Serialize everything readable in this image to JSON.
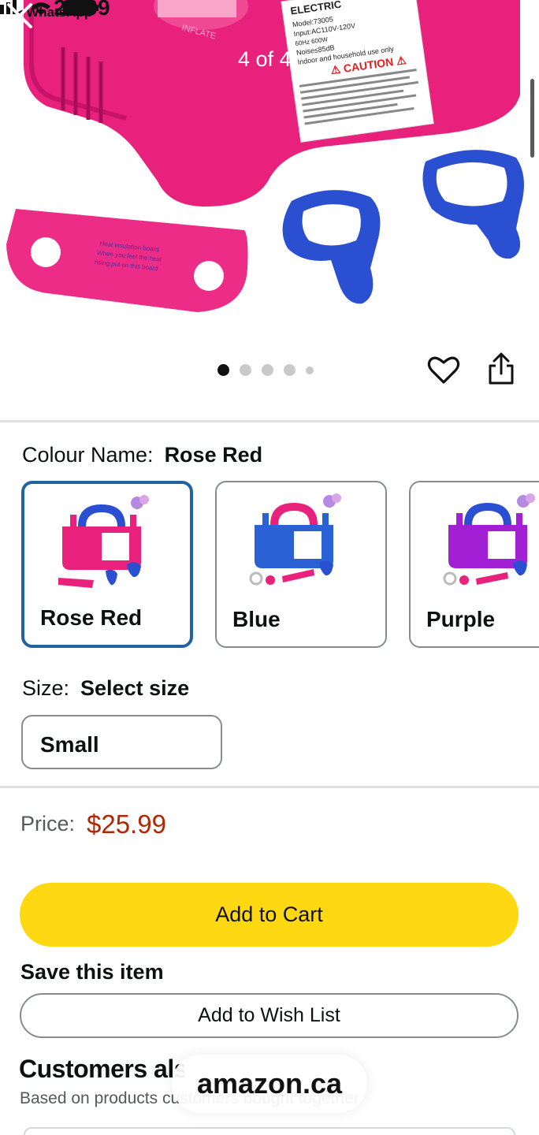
{
  "status_bar": {
    "back_app": "◂ WhatsApp",
    "time": "20:09"
  },
  "gallery": {
    "counter": "4 of 4",
    "dots_total": 5,
    "active_dot": 0,
    "product_label_lines": [
      "ELECTRIC",
      "Model:73005",
      "Input:AC110V-120V",
      "60Hz 600W",
      "Noise≤85dB",
      "Indoor and household use only",
      "⚠ CAUTION ⚠"
    ],
    "board_text": [
      "Heat insulation board",
      "When you feel the heat",
      "rising,put on this board"
    ],
    "inflate_text": "INFLATE"
  },
  "colour": {
    "label": "Colour Name:",
    "selected": "Rose Red",
    "options": [
      {
        "name": "Rose Red",
        "color": "#e8217d",
        "accent": "#2a4fd1"
      },
      {
        "name": "Blue",
        "color": "#2a62d6",
        "accent": "#e8217d"
      },
      {
        "name": "Purple",
        "color": "#a21fd6",
        "accent": "#2a4fd1"
      }
    ]
  },
  "size": {
    "label": "Size:",
    "value": "Select size",
    "option": "Small"
  },
  "price": {
    "label": "Price:",
    "value": "$25.99"
  },
  "actions": {
    "add_to_cart": "Add to Cart",
    "save_title": "Save this item",
    "add_to_wish_list": "Add to Wish List"
  },
  "customers": {
    "title": "Customers also bought",
    "subtitle": "Based on products customers bought together"
  },
  "overlay": {
    "site": "amazon.ca"
  },
  "colors": {
    "cart_yellow": "#ffd814",
    "price_red": "#b12704",
    "selected_border": "#2162a1",
    "product_pink": "#e8217d"
  }
}
